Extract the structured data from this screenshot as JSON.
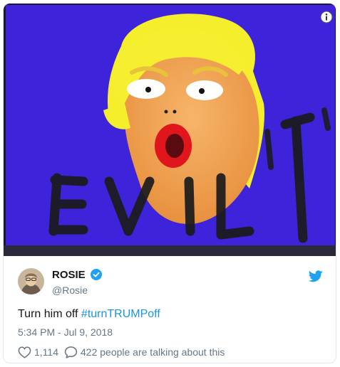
{
  "tweet": {
    "display_name": "ROSIE",
    "handle": "@Rosie",
    "text_prefix": "Turn him off ",
    "hashtag": "#turnTRUMPoff",
    "timestamp": "5:34 PM - Jul 9, 2018",
    "likes": "1,114",
    "talking": "422 people are talking about this"
  },
  "media": {
    "painted_text": "EVIL",
    "background_color": "#3a21d6",
    "hair_color": "#f4ee2c",
    "face_color": "#f0a153"
  },
  "colors": {
    "link": "#1b95e0",
    "verified": "#1da1f2",
    "text": "#14171a",
    "muted": "#657786"
  },
  "icons": [
    "info-icon",
    "verified-badge-icon",
    "twitter-bird-icon",
    "heart-icon",
    "speech-bubble-icon"
  ]
}
